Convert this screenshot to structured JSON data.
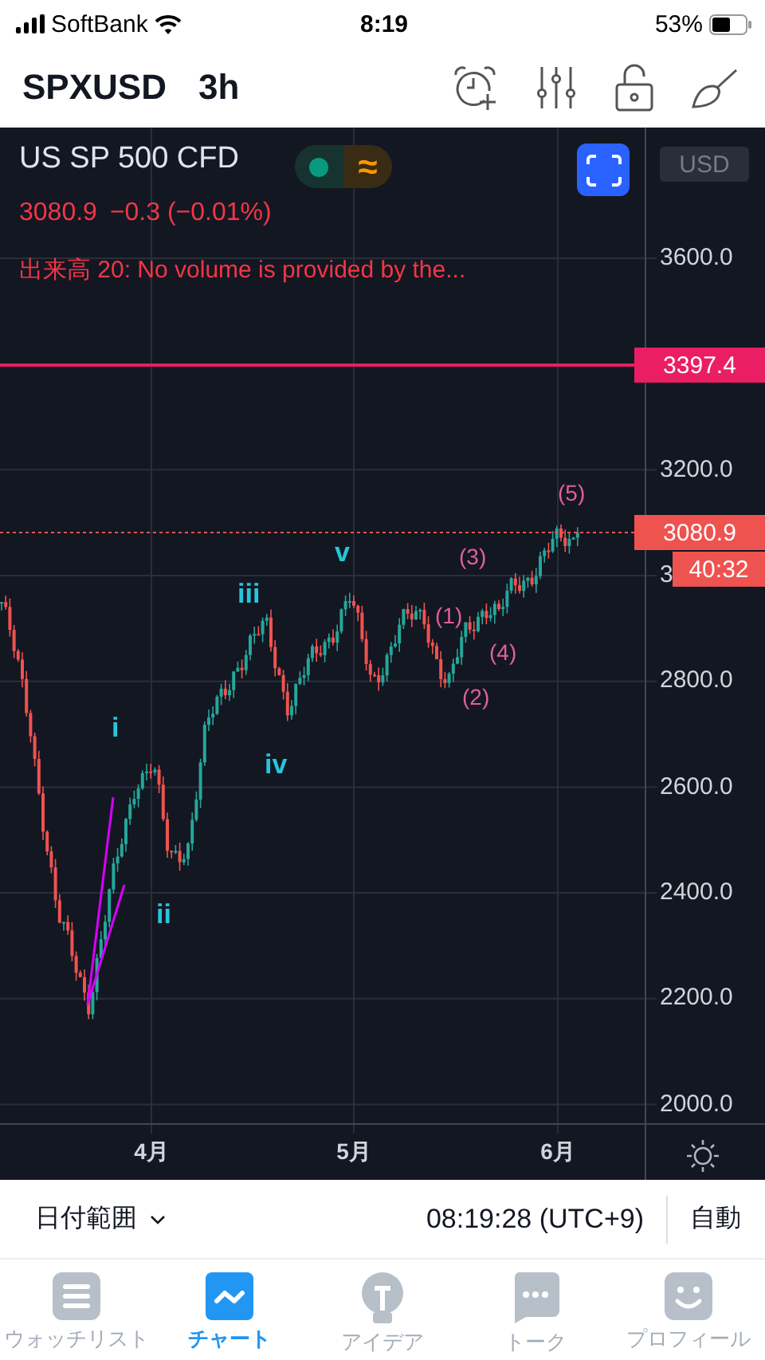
{
  "status_bar": {
    "carrier": "SoftBank",
    "time": "8:19",
    "battery": "53%"
  },
  "header": {
    "symbol": "SPXUSD",
    "interval": "3h"
  },
  "legend": {
    "name": "US SP 500 CFD",
    "delay_mark": "≈",
    "price": "3080.9",
    "change": "−0.3 (−0.01%)",
    "volume_note": "出来高 20: No volume is provided by the..."
  },
  "currency": "USD",
  "price_axis": [
    "3600.0",
    "3200.0",
    "3",
    "2800.0",
    "2600.0",
    "2400.0",
    "2200.0",
    "2000.0"
  ],
  "horizontal_line_label": "3397.4",
  "last_price": "3080.9",
  "countdown": "40:32",
  "time_axis": [
    "4月",
    "5月",
    "6月"
  ],
  "wave_labels": [
    {
      "text": "i",
      "kind": "major"
    },
    {
      "text": "ii",
      "kind": "major"
    },
    {
      "text": "iii",
      "kind": "major"
    },
    {
      "text": "iv",
      "kind": "major"
    },
    {
      "text": "v",
      "kind": "major"
    },
    {
      "text": "(1)",
      "kind": "minor"
    },
    {
      "text": "(2)",
      "kind": "minor"
    },
    {
      "text": "(3)",
      "kind": "minor"
    },
    {
      "text": "(4)",
      "kind": "minor"
    },
    {
      "text": "(5)",
      "kind": "minor"
    }
  ],
  "toolbar": {
    "date_range": "日付範囲",
    "time": "08:19:28 (UTC+9)",
    "scale": "自動"
  },
  "tabs": [
    {
      "label": "ウォッチリスト",
      "selected": false
    },
    {
      "label": "チャート",
      "selected": true
    },
    {
      "label": "アイデア",
      "selected": false
    },
    {
      "label": "トーク",
      "selected": false
    },
    {
      "label": "プロフィール",
      "selected": false
    }
  ]
}
